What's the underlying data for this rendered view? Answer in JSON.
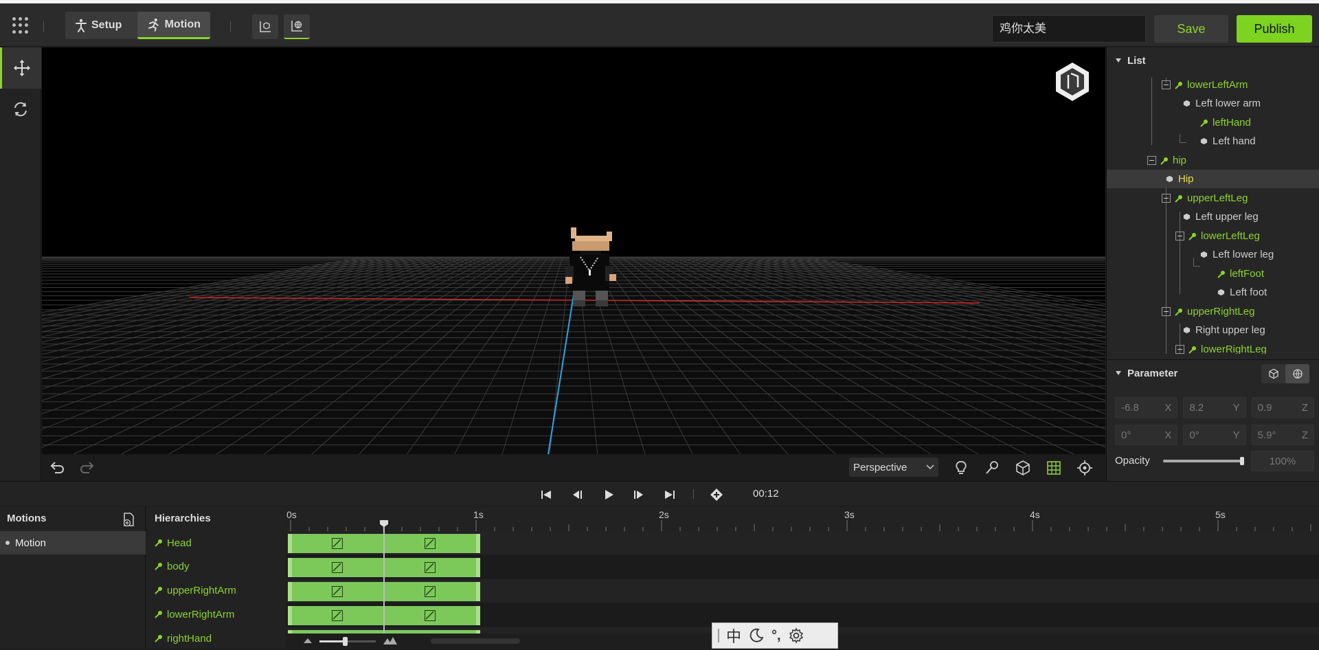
{
  "toolbar": {
    "modes": [
      {
        "label": "Setup"
      },
      {
        "label": "Motion"
      }
    ],
    "active_mode": "Motion",
    "name_value": "鸡你太美",
    "save_label": "Save",
    "publish_label": "Publish"
  },
  "viewport": {
    "camera_mode": "Perspective"
  },
  "list_panel": {
    "title": "List",
    "items": [
      {
        "label": "lowerLeftArm",
        "kind": "bone"
      },
      {
        "label": "Left lower arm",
        "kind": "object"
      },
      {
        "label": "leftHand",
        "kind": "bone"
      },
      {
        "label": "Left hand",
        "kind": "object"
      },
      {
        "label": "hip",
        "kind": "bone"
      },
      {
        "label": "Hip",
        "kind": "object",
        "selected": true
      },
      {
        "label": "upperLeftLeg",
        "kind": "bone"
      },
      {
        "label": "Left upper leg",
        "kind": "object"
      },
      {
        "label": "lowerLeftLeg",
        "kind": "bone"
      },
      {
        "label": "Left lower leg",
        "kind": "object"
      },
      {
        "label": "leftFoot",
        "kind": "bone"
      },
      {
        "label": "Left foot",
        "kind": "object"
      },
      {
        "label": "upperRightLeg",
        "kind": "bone"
      },
      {
        "label": "Right upper leg",
        "kind": "object"
      },
      {
        "label": "lowerRightLeg",
        "kind": "bone"
      }
    ]
  },
  "parameter_panel": {
    "title": "Parameter",
    "position": {
      "x": "-6.8",
      "y": "8.2",
      "z": "0.9"
    },
    "rotation": {
      "x": "0°",
      "y": "0°",
      "z": "5.9°"
    },
    "axis_labels": {
      "x": "X",
      "y": "Y",
      "z": "Z"
    },
    "opacity_label": "Opacity",
    "opacity_value": "100%",
    "opacity_fraction": 1.0
  },
  "transport": {
    "time": "00:12"
  },
  "motions_panel": {
    "title": "Motions",
    "items": [
      {
        "label": "Motion"
      }
    ]
  },
  "hierarchies": {
    "title": "Hierarchies",
    "items": [
      {
        "label": "Head"
      },
      {
        "label": "body"
      },
      {
        "label": "upperRightArm"
      },
      {
        "label": "lowerRightArm"
      },
      {
        "label": "rightHand"
      }
    ]
  },
  "timeline": {
    "ruler_labels": [
      "0s",
      "1s",
      "2s",
      "3s",
      "4s",
      "5s"
    ],
    "playhead_seconds": 0.5,
    "clip_end_seconds": 1.0
  },
  "ime_bar": {
    "lang": "中",
    "punct": "°,"
  },
  "colors": {
    "accent": "#8cd42a",
    "clip": "#7cc95a",
    "selected_text": "#e8e04a"
  }
}
